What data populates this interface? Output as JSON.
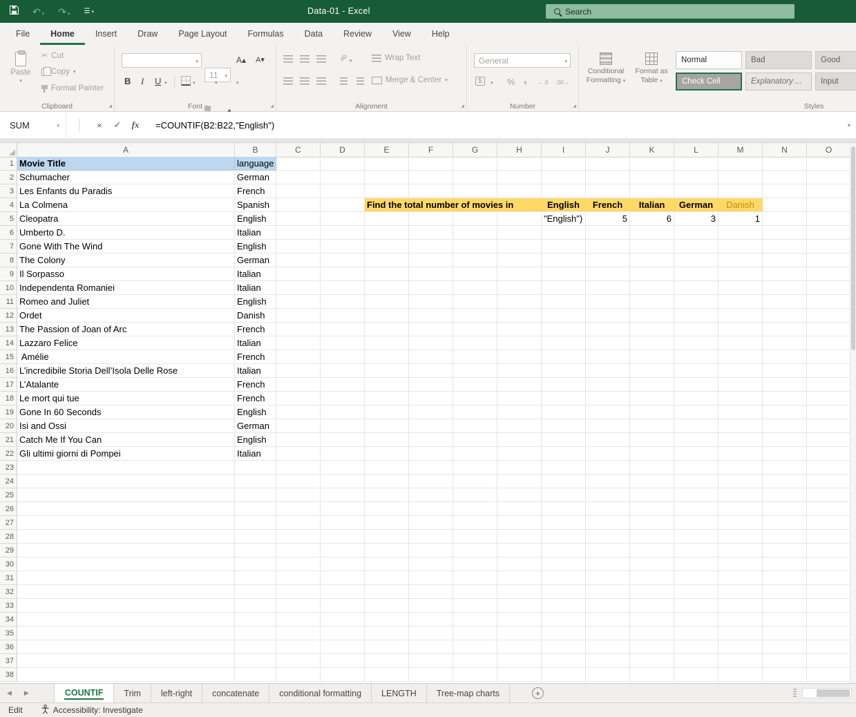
{
  "colors": {
    "title_green": "#185c37",
    "accent_green": "#217346",
    "yellow_fill": "#ffd966",
    "blue_fill": "#bdd7ee",
    "danish_text": "#bf8f00"
  },
  "title_bar": {
    "title": "Data-01  -  Excel",
    "search_placeholder": "Search"
  },
  "ribbon_tabs": [
    {
      "label": "File"
    },
    {
      "label": "Home",
      "active": true
    },
    {
      "label": "Insert"
    },
    {
      "label": "Draw"
    },
    {
      "label": "Page Layout"
    },
    {
      "label": "Formulas"
    },
    {
      "label": "Data"
    },
    {
      "label": "Review"
    },
    {
      "label": "View"
    },
    {
      "label": "Help"
    }
  ],
  "ribbon": {
    "clipboard": {
      "label": "Clipboard",
      "paste": "Paste",
      "cut": "Cut",
      "copy": "Copy",
      "format_painter": "Format Painter"
    },
    "font": {
      "label": "Font",
      "font_name": "",
      "font_size": "11",
      "bold": "B",
      "italic": "I",
      "underline": "U"
    },
    "alignment": {
      "label": "Alignment",
      "wrap_text": "Wrap Text",
      "merge_center": "Merge & Center"
    },
    "number": {
      "label": "Number",
      "format": "General",
      "percent": "%",
      "comma": ",",
      "currency": "$",
      "increase_decimal": "←.0",
      "decrease_decimal": ".00→"
    },
    "styles": {
      "label": "Styles",
      "conditional_line1": "Conditional",
      "conditional_line2": "Formatting",
      "format_table_line1": "Format as",
      "format_table_line2": "Table",
      "gallery": [
        {
          "label": "Normal",
          "style": "normal"
        },
        {
          "label": "Bad",
          "style": "bad"
        },
        {
          "label": "Good",
          "style": "good"
        },
        {
          "label": "Check Cell",
          "style": "check",
          "selected": true
        },
        {
          "label": "Explanatory ...",
          "style": "explanatory"
        },
        {
          "label": "Input",
          "style": "input"
        }
      ]
    }
  },
  "formula_bar": {
    "name_box": "SUM",
    "cancel": "×",
    "enter": "✓",
    "fx": "fx",
    "formula": "=COUNTIF(B2:B22,\"English\")"
  },
  "grid": {
    "column_letters": [
      "A",
      "B",
      "C",
      "D",
      "E",
      "F",
      "G",
      "H",
      "I",
      "J",
      "K",
      "L",
      "M",
      "N",
      "O"
    ],
    "row_count": 38,
    "movies": [
      [
        "Movie Title",
        "language"
      ],
      [
        "Schumacher",
        "German"
      ],
      [
        "Les Enfants du Paradis",
        "French"
      ],
      [
        "La Colmena",
        "Spanish"
      ],
      [
        "Cleopatra",
        "English"
      ],
      [
        "Umberto D.",
        "Italian"
      ],
      [
        "Gone With The Wind",
        "English"
      ],
      [
        "The Colony",
        "German"
      ],
      [
        "Il Sorpasso",
        "Italian"
      ],
      [
        "Independenta Romaniei",
        "Italian"
      ],
      [
        "Romeo and Juliet",
        "English"
      ],
      [
        "Ordet",
        "Danish"
      ],
      [
        "The Passion of Joan of Arc",
        "French"
      ],
      [
        "Lazzaro Felice",
        "Italian"
      ],
      [
        " Amélie",
        "French"
      ],
      [
        "L’incredibile Storia Dell’Isola Delle Rose",
        "Italian"
      ],
      [
        "L’Atalante",
        "French"
      ],
      [
        "Le mort qui tue",
        "French"
      ],
      [
        "Gone In 60 Seconds",
        "English"
      ],
      [
        "Isi and Ossi",
        "German"
      ],
      [
        "Catch Me If You Can",
        "English"
      ],
      [
        "Gli ultimi giorni di Pompei",
        "Italian"
      ]
    ],
    "task": {
      "prompt": "Find the total number of movies in",
      "language_columns": [
        "I",
        "J",
        "K",
        "L",
        "M"
      ],
      "languages": [
        "English",
        "French",
        "Italian",
        "German",
        "Danish"
      ],
      "editing_text": "\"English\")",
      "counts": [
        "5",
        "6",
        "3",
        "1"
      ]
    }
  },
  "sheet_tabs": [
    {
      "label": "COUNTIF",
      "active": true
    },
    {
      "label": "Trim"
    },
    {
      "label": "left-right"
    },
    {
      "label": "concatenate"
    },
    {
      "label": "conditional formatting"
    },
    {
      "label": "LENGTH"
    },
    {
      "label": "Tree-map charts"
    }
  ],
  "status_bar": {
    "mode": "Edit",
    "accessibility": "Accessibility: Investigate"
  }
}
